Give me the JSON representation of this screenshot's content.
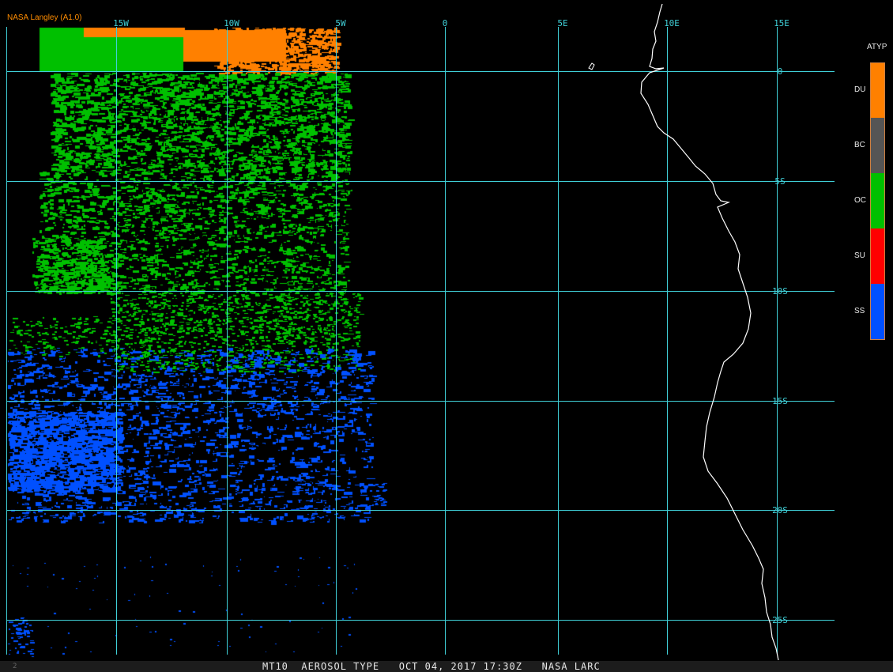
{
  "credit": "NASA Langley (A1.0)",
  "footer": {
    "left_mark": "2",
    "text": "MT10  AEROSOL TYPE   OCT 04, 2017 17:30Z   NASA LARC"
  },
  "grid": {
    "longitude_labels": [
      "15W",
      "10W",
      "5W",
      "0",
      "5E",
      "10E",
      "15E"
    ],
    "latitude_labels": [
      "0",
      "5S",
      "10S",
      "15S",
      "20S",
      "25S"
    ],
    "color": "#40d0d8"
  },
  "legend": {
    "title": "ATYP",
    "classes": [
      {
        "code": "DU",
        "color": "#ff8000"
      },
      {
        "code": "BC",
        "color": "#555555"
      },
      {
        "code": "OC",
        "color": "#00c000"
      },
      {
        "code": "SU",
        "color": "#ff0000"
      },
      {
        "code": "SS",
        "color": "#0050ff"
      }
    ]
  },
  "colors": {
    "coastline": "#ffffff",
    "background": "#000000"
  }
}
